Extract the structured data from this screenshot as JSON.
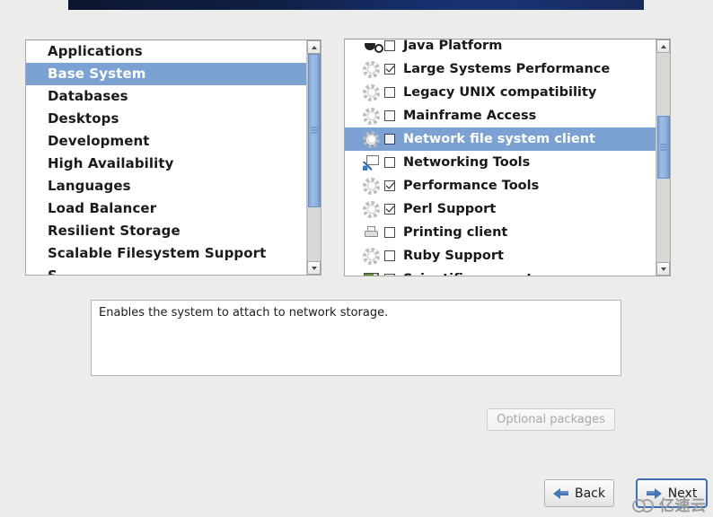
{
  "window": {
    "banner_color": "#142a63",
    "background_color": "#ececeb"
  },
  "categories": {
    "panel_name": "environment-group-list",
    "selected": "Base System",
    "items": [
      {
        "label": "Applications",
        "selected": false
      },
      {
        "label": "Base System",
        "selected": true
      },
      {
        "label": "Databases",
        "selected": false
      },
      {
        "label": "Desktops",
        "selected": false
      },
      {
        "label": "Development",
        "selected": false
      },
      {
        "label": "High Availability",
        "selected": false
      },
      {
        "label": "Languages",
        "selected": false
      },
      {
        "label": "Load Balancer",
        "selected": false
      },
      {
        "label": "Resilient Storage",
        "selected": false
      },
      {
        "label": "Scalable Filesystem Support",
        "selected": false
      },
      {
        "label": "S",
        "selected": false
      }
    ],
    "scrollbar": {
      "thumb_top_pct": 0,
      "thumb_height_pct": 74,
      "up_arrow": "scroll-up-arrow",
      "down_arrow": "scroll-down-arrow"
    }
  },
  "addons": {
    "panel_name": "addon-group-list",
    "selected": "Network file system client",
    "items": [
      {
        "label": "Java Platform",
        "checked": false,
        "selected": false,
        "icon": "coffee-cup-icon"
      },
      {
        "label": "Large Systems Performance",
        "checked": true,
        "selected": false,
        "icon": "gear-icon"
      },
      {
        "label": "Legacy UNIX compatibility",
        "checked": false,
        "selected": false,
        "icon": "gear-icon"
      },
      {
        "label": "Mainframe Access",
        "checked": false,
        "selected": false,
        "icon": "gear-icon"
      },
      {
        "label": "Network file system client",
        "checked": false,
        "selected": true,
        "icon": "gear-icon"
      },
      {
        "label": "Networking Tools",
        "checked": false,
        "selected": false,
        "icon": "network-tools-icon"
      },
      {
        "label": "Performance Tools",
        "checked": true,
        "selected": false,
        "icon": "gear-icon"
      },
      {
        "label": "Perl Support",
        "checked": true,
        "selected": false,
        "icon": "gear-icon"
      },
      {
        "label": "Printing client",
        "checked": false,
        "selected": false,
        "icon": "printer-icon"
      },
      {
        "label": "Ruby Support",
        "checked": false,
        "selected": false,
        "icon": "gear-icon"
      },
      {
        "label": "Scientific support",
        "checked": false,
        "selected": false,
        "icon": "science-icon"
      }
    ],
    "scrollbar": {
      "thumb_top_pct": 30,
      "thumb_height_pct": 30,
      "up_arrow": "scroll-up-arrow",
      "down_arrow": "scroll-down-arrow"
    }
  },
  "description": {
    "text": "Enables the system to attach to network storage."
  },
  "buttons": {
    "optional_packages": {
      "label": "Optional packages",
      "enabled": false
    },
    "back": {
      "label": "Back",
      "icon": "arrow-left-icon"
    },
    "next": {
      "label": "Next",
      "icon": "arrow-right-icon",
      "focused": true
    }
  },
  "watermark": {
    "text": "亿速云",
    "logo": "cloud-logo-icon"
  }
}
